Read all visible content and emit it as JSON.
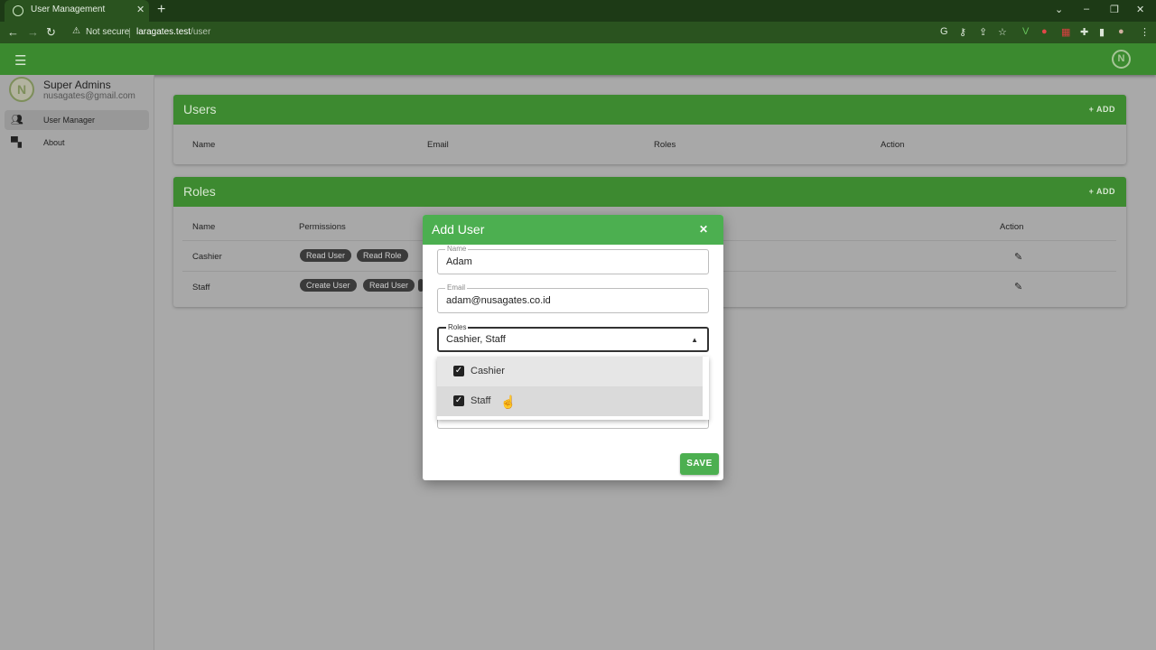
{
  "browser": {
    "tab_title": "User Management",
    "tab_close": "✕",
    "new_tab": "+",
    "security_label": "Not secure",
    "url_host": "laragates.test",
    "url_path": "/user"
  },
  "app": {
    "accent": "#4caf50"
  },
  "sidebar": {
    "user_name": "Super Admins",
    "user_email": "nusagates@gmail.com",
    "avatar_letter": "N",
    "items": [
      {
        "label": "User Manager",
        "icon": "people-icon",
        "active": true
      },
      {
        "label": "About",
        "icon": "forum-icon",
        "active": false
      }
    ]
  },
  "users_card": {
    "title": "Users",
    "add_label": "+ ADD",
    "columns": [
      "Name",
      "Email",
      "Roles",
      "Action"
    ]
  },
  "roles_card": {
    "title": "Roles",
    "add_label": "+ ADD",
    "columns": [
      "Name",
      "Permissions",
      "Action"
    ],
    "rows": [
      {
        "name": "Cashier",
        "permissions": [
          "Read User",
          "Read Role"
        ]
      },
      {
        "name": "Staff",
        "permissions": [
          "Create User",
          "Read User"
        ]
      }
    ]
  },
  "dialog": {
    "title": "Add User",
    "close": "✕",
    "name_label": "Name",
    "name_value": "Adam",
    "email_label": "Email",
    "email_value": "adam@nusagates.co.id",
    "roles_label": "Roles",
    "roles_value": "Cashier, Staff",
    "options": [
      {
        "label": "Cashier",
        "checked": true
      },
      {
        "label": "Staff",
        "checked": true
      }
    ],
    "save_label": "SAVE"
  }
}
